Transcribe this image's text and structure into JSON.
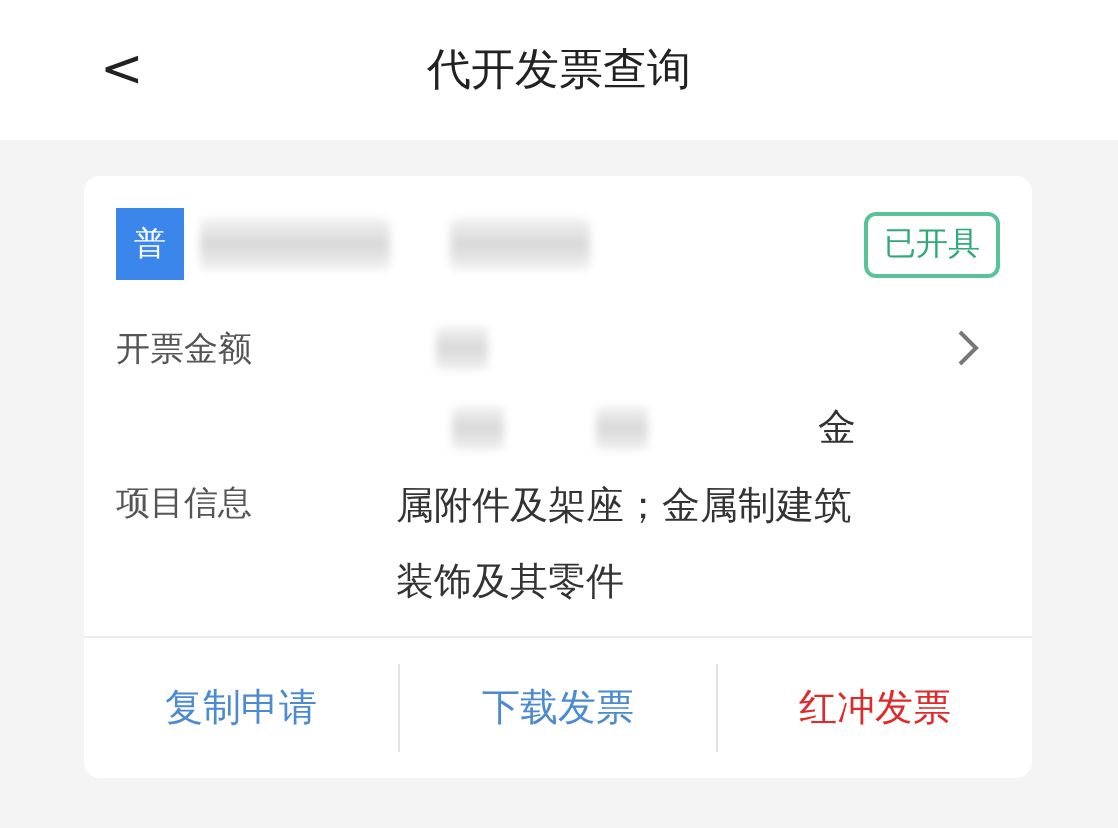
{
  "nav": {
    "back": "<",
    "title": "代开发票查询"
  },
  "invoice": {
    "type_badge": "普",
    "status": "已开具",
    "amount_label": "开票金额",
    "item_label": "项目信息",
    "item_value_line_end": "金",
    "item_value": "属附件及架座；金属制建筑装饰及其零件"
  },
  "actions": [
    {
      "label": "复制申请",
      "kind": "normal"
    },
    {
      "label": "下载发票",
      "kind": "normal"
    },
    {
      "label": "红冲发票",
      "kind": "danger"
    }
  ]
}
